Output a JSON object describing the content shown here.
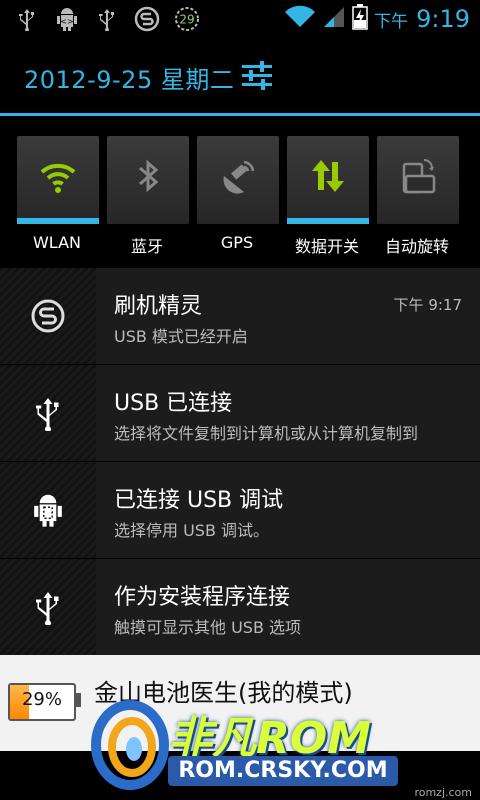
{
  "status_bar": {
    "ampm": "下午",
    "time": "9:19",
    "badge": "29",
    "icons_left": [
      "usb-icon",
      "android-debug-icon",
      "usb-icon",
      "flash-app-icon",
      "badge-icon"
    ],
    "icons_right": [
      "wifi-icon",
      "signal-icon",
      "battery-charging-icon"
    ]
  },
  "header": {
    "date": "2012-9-25 星期二"
  },
  "toggles": [
    {
      "label": "WLAN",
      "active": true,
      "icon": "wifi-icon"
    },
    {
      "label": "蓝牙",
      "active": false,
      "icon": "bluetooth-icon"
    },
    {
      "label": "GPS",
      "active": false,
      "icon": "gps-icon"
    },
    {
      "label": "数据开关",
      "active": true,
      "icon": "data-icon"
    },
    {
      "label": "自动旋转",
      "active": false,
      "icon": "rotate-icon"
    }
  ],
  "notifications": [
    {
      "title": "刷机精灵",
      "text": "USB 模式已经开启",
      "time": "下午 9:17",
      "icon": "flash-app-icon"
    },
    {
      "title": "USB 已连接",
      "text": "选择将文件复制到计算机或从计算机复制到",
      "time": "",
      "icon": "usb-icon"
    },
    {
      "title": "已连接 USB 调试",
      "text": "选择停用 USB 调试。",
      "time": "",
      "icon": "android-debug-icon"
    },
    {
      "title": "作为安装程序连接",
      "text": "触摸可显示其他 USB 选项",
      "time": "",
      "icon": "usb-icon"
    }
  ],
  "battery_notification": {
    "title": "金山电池医生(我的模式)",
    "percent_label": "29%",
    "level": 0.29,
    "fill_color": "#ff9a1a"
  },
  "watermark": {
    "brand": "非凡ROM",
    "url": "ROM.CRSKY.COM",
    "small": "romzj.com"
  },
  "colors": {
    "accent": "#33b5e5",
    "active_icon": "#99cc00"
  }
}
